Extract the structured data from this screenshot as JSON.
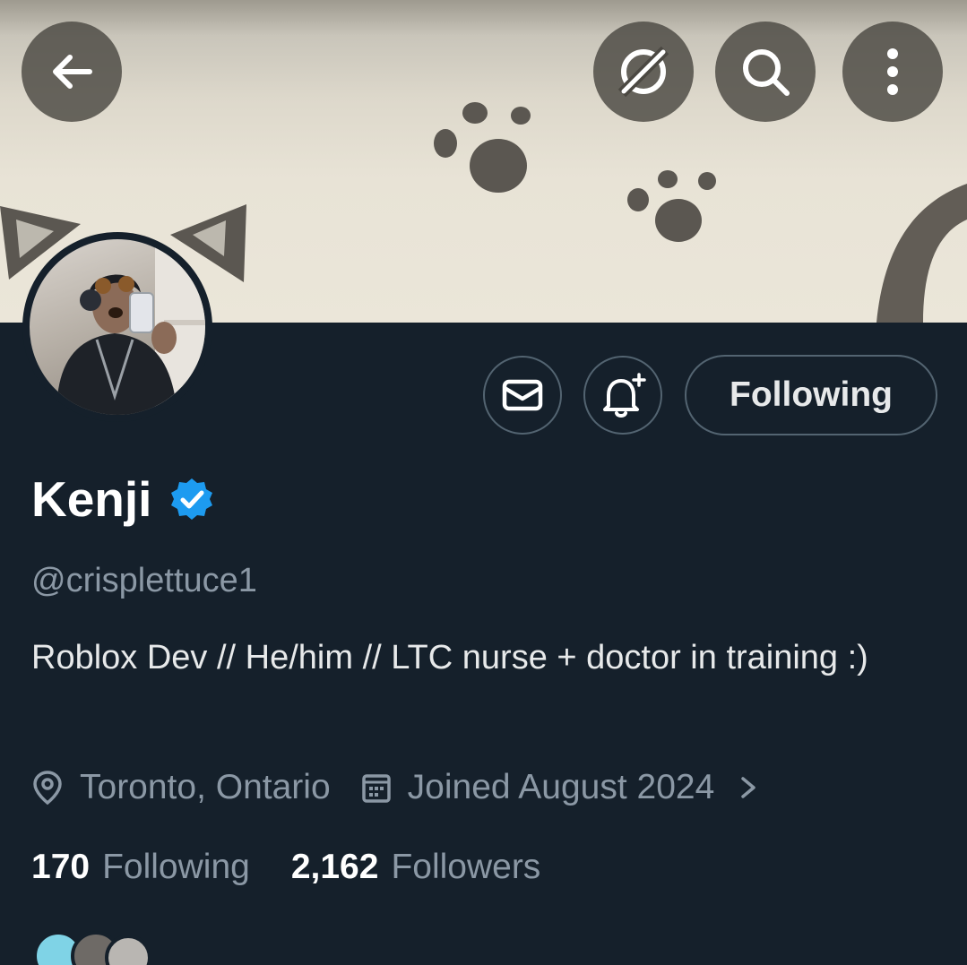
{
  "header": {
    "back_icon": "arrow-left-icon",
    "grok_icon": "grok-icon",
    "search_icon": "search-icon",
    "more_icon": "more-vertical-icon"
  },
  "profile": {
    "name": "Kenji",
    "verified": true,
    "handle": "@crisplettuce1",
    "bio": "Roblox Dev // He/him // LTC nurse + doctor in training :)",
    "location": "Toronto, Ontario",
    "joined": "Joined August 2024",
    "following_count": "170",
    "following_label": "Following",
    "followers_count": "2,162",
    "followers_label": "Followers"
  },
  "actions": {
    "message_icon": "mail-icon",
    "notify_icon": "bell-plus-icon",
    "follow_label": "Following"
  },
  "colors": {
    "background": "#15202b",
    "primary_text": "#e7e9ea",
    "secondary_text": "#8b98a5",
    "border": "#536471",
    "verified_blue": "#1d9bf0"
  }
}
